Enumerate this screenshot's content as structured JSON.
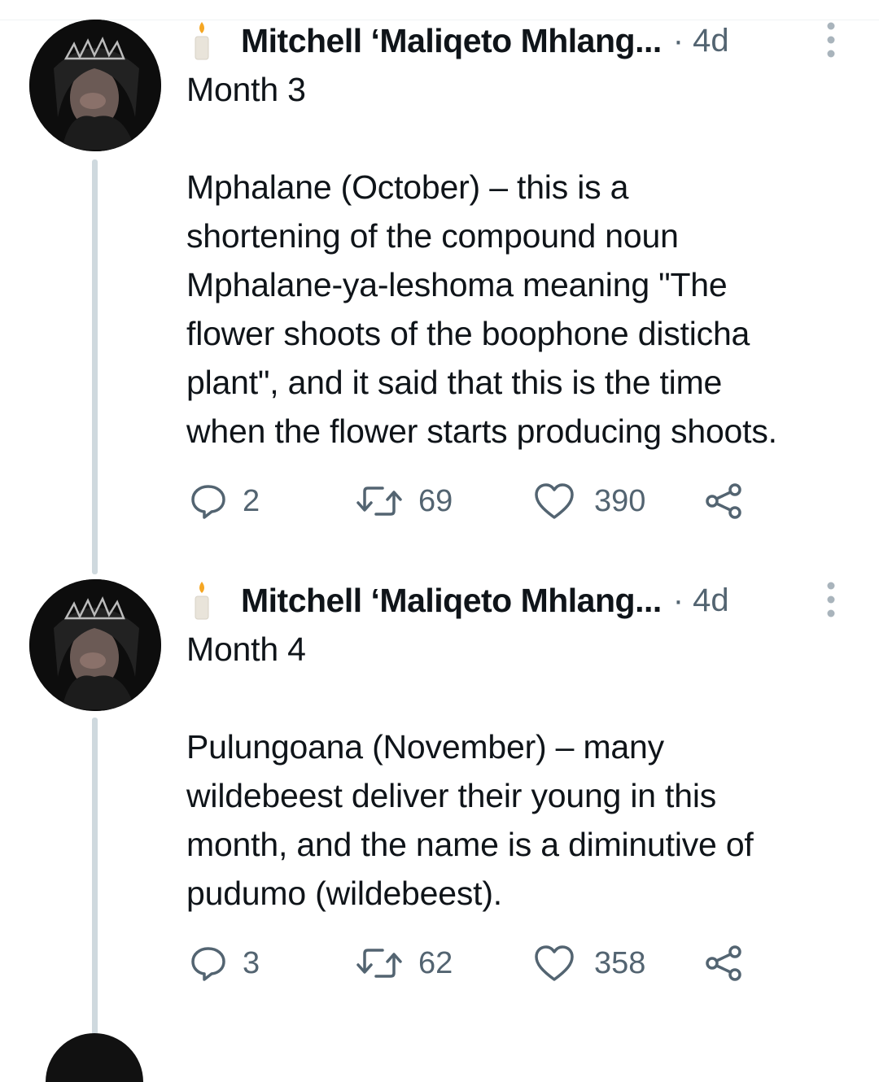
{
  "tweets": [
    {
      "author": "Mitchell ‘Maliqeto Mhlang...",
      "meta": "· 4d",
      "body": "Month 3\n\nMphalane (October) – this is a\nshortening of the compound noun\nMphalane-ya-leshoma meaning \"The\nflower shoots of the boophone disticha\nplant\", and it said that this is the time\nwhen the flower starts producing shoots.",
      "replies": "2",
      "retweets": "69",
      "likes": "390"
    },
    {
      "author": "Mitchell ‘Maliqeto Mhlang...",
      "meta": "· 4d",
      "body": "Month 4\n\nPulungoana (November) – many\nwildebeest deliver their young in this\nmonth, and the name is a diminutive of\npudumo (wildebeest).",
      "replies": "3",
      "retweets": "62",
      "likes": "358"
    }
  ],
  "icons": {
    "name_emoji": "candle-icon",
    "more": "more-vertical-icon",
    "reply": "reply-icon",
    "retweet": "retweet-icon",
    "like": "heart-icon",
    "share": "share-icon"
  },
  "colors": {
    "text": "#0f1419",
    "secondary": "#536471",
    "thread_line": "#cfd9de"
  }
}
